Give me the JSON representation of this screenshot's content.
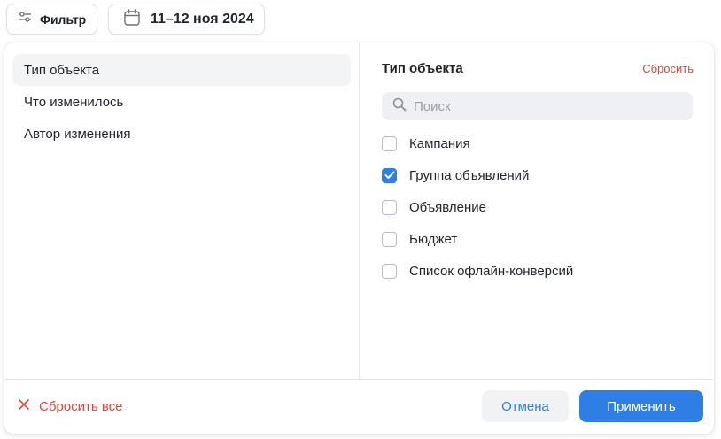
{
  "toolbar": {
    "filter_label": "Фильтр",
    "date_label": "11–12 ноя 2024"
  },
  "categories": [
    {
      "label": "Тип объекта",
      "active": true
    },
    {
      "label": "Что изменилось",
      "active": false
    },
    {
      "label": "Автор изменения",
      "active": false
    }
  ],
  "detail": {
    "title": "Тип объекта",
    "reset_label": "Сбросить",
    "search_placeholder": "Поиск",
    "options": [
      {
        "label": "Кампания",
        "checked": false
      },
      {
        "label": "Группа объявлений",
        "checked": true
      },
      {
        "label": "Объявление",
        "checked": false
      },
      {
        "label": "Бюджет",
        "checked": false
      },
      {
        "label": "Список офлайн-конверсий",
        "checked": false
      }
    ]
  },
  "footer": {
    "reset_all_label": "Сбросить все",
    "cancel_label": "Отмена",
    "apply_label": "Применить"
  },
  "colors": {
    "accent": "#2f7ee6",
    "danger": "#e0463c"
  },
  "icons": {
    "filter": "sliders-icon",
    "date": "calendar-icon",
    "search": "search-icon",
    "reset_all": "close-icon",
    "check": "checkmark-icon"
  }
}
